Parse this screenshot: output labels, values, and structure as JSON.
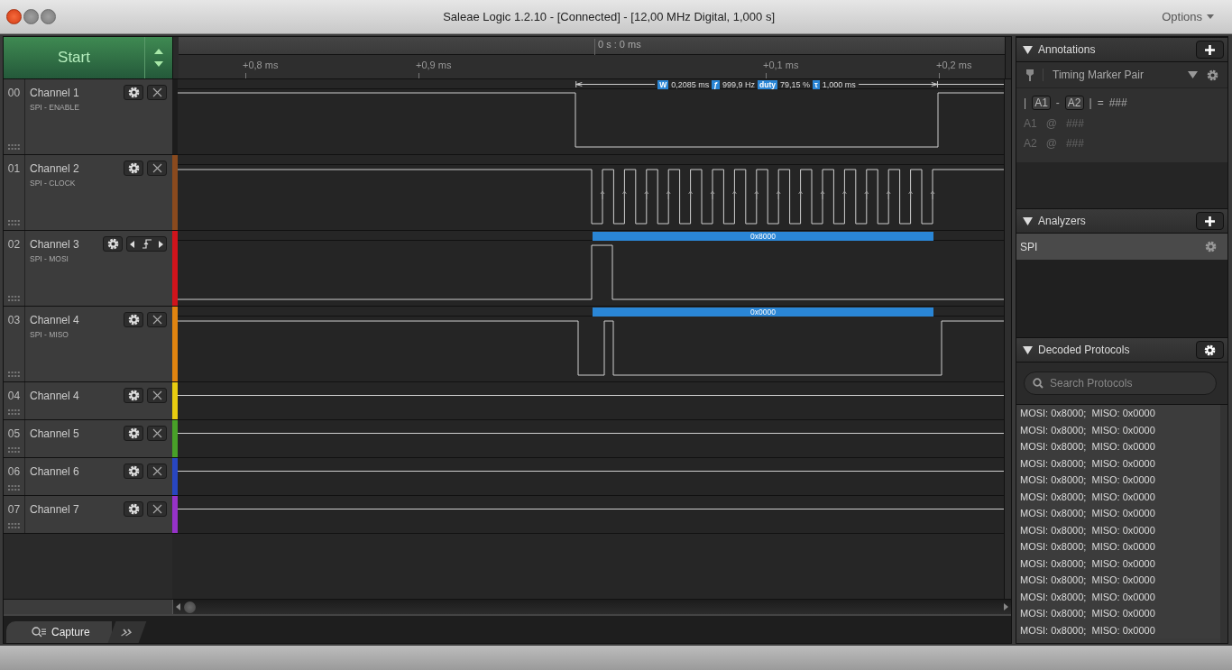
{
  "window": {
    "title": "Saleae Logic 1.2.10 - [Connected] - [12,00 MHz Digital, 1,000 s]",
    "options_menu": "Options"
  },
  "start_button": {
    "label": "Start"
  },
  "ruler": {
    "origin": "0 s : 0 ms",
    "ticks": [
      "+0,8 ms",
      "+0,9 ms",
      "+0,1 ms",
      "+0,2 ms"
    ]
  },
  "measurement": [
    {
      "badge": "W",
      "value": "0,2085 ms"
    },
    {
      "badge": "ƒ",
      "value": "999,9 Hz"
    },
    {
      "badge": "duty",
      "value": "79,15 %"
    },
    {
      "badge": "τ",
      "value": "1,000 ms"
    }
  ],
  "channels": [
    {
      "number": "00",
      "name": "Channel 1",
      "label": "SPI - ENABLE",
      "color": "#1c1c1c",
      "kind": "plain"
    },
    {
      "number": "01",
      "name": "Channel 2",
      "label": "SPI - CLOCK",
      "color": "#8a4a1e",
      "kind": "plain"
    },
    {
      "number": "02",
      "name": "Channel 3",
      "label": "SPI - MOSI",
      "color": "#d0141c",
      "kind": "trigger",
      "decoded": "0x8000"
    },
    {
      "number": "03",
      "name": "Channel 4",
      "label": "SPI - MISO",
      "color": "#e08410",
      "kind": "plain",
      "decoded": "0x0000"
    },
    {
      "number": "04",
      "name": "Channel 4",
      "color": "#e8cc10",
      "kind": "plain"
    },
    {
      "number": "05",
      "name": "Channel 5",
      "color": "#48a028",
      "kind": "plain"
    },
    {
      "number": "06",
      "name": "Channel 6",
      "color": "#2846c0",
      "kind": "plain"
    },
    {
      "number": "07",
      "name": "Channel 7",
      "color": "#9632c8",
      "kind": "plain"
    }
  ],
  "annotations": {
    "title": "Annotations",
    "marker_type": "Timing Marker Pair",
    "formula": [
      {
        "text": "|",
        "kind": "plain"
      },
      {
        "text": "A1",
        "kind": "tag"
      },
      {
        "text": "-",
        "kind": "plain"
      },
      {
        "text": "A2",
        "kind": "tag"
      },
      {
        "text": "|",
        "kind": "plain"
      },
      {
        "text": "=",
        "kind": "plain"
      },
      {
        "text": "###",
        "kind": "plain"
      }
    ],
    "markers": [
      {
        "name": "A1",
        "at": "@",
        "value": "###"
      },
      {
        "name": "A2",
        "at": "@",
        "value": "###"
      }
    ]
  },
  "analyzers": {
    "title": "Analyzers",
    "items": [
      {
        "name": "SPI"
      }
    ]
  },
  "decoded_protocols": {
    "title": "Decoded Protocols",
    "search": {
      "placeholder": "Search Protocols"
    },
    "rows": [
      "MOSI: 0x8000;  MISO: 0x0000",
      "MOSI: 0x8000;  MISO: 0x0000",
      "MOSI: 0x8000;  MISO: 0x0000",
      "MOSI: 0x8000;  MISO: 0x0000",
      "MOSI: 0x8000;  MISO: 0x0000",
      "MOSI: 0x8000;  MISO: 0x0000",
      "MOSI: 0x8000;  MISO: 0x0000",
      "MOSI: 0x8000;  MISO: 0x0000",
      "MOSI: 0x8000;  MISO: 0x0000",
      "MOSI: 0x8000;  MISO: 0x0000",
      "MOSI: 0x8000;  MISO: 0x0000",
      "MOSI: 0x8000;  MISO: 0x0000",
      "MOSI: 0x8000;  MISO: 0x0000",
      "MOSI: 0x8000;  MISO: 0x0000"
    ]
  },
  "tabs": [
    {
      "label": "Capture",
      "selected": true
    }
  ]
}
